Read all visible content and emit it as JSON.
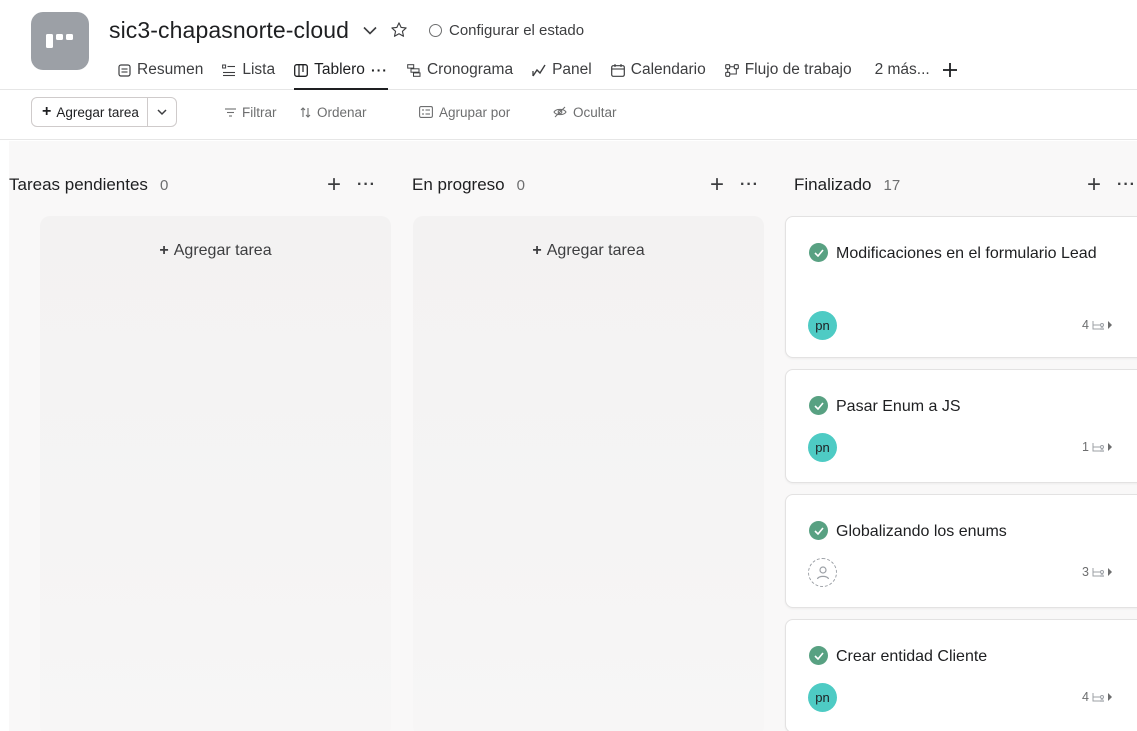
{
  "project": {
    "title": "sic3-chapasnorte-cloud",
    "status_label": "Configurar el estado"
  },
  "tabs": [
    {
      "label": "Resumen",
      "icon": "overview-icon"
    },
    {
      "label": "Lista",
      "icon": "list-icon"
    },
    {
      "label": "Tablero",
      "icon": "board-icon",
      "active": true,
      "dots": "···"
    },
    {
      "label": "Cronograma",
      "icon": "timeline-icon"
    },
    {
      "label": "Panel",
      "icon": "dashboard-icon"
    },
    {
      "label": "Calendario",
      "icon": "calendar-icon"
    },
    {
      "label": "Flujo de trabajo",
      "icon": "workflow-icon"
    }
  ],
  "tabs_more": "2 más...",
  "toolbar": {
    "add_task": "Agregar tarea",
    "filter": "Filtrar",
    "sort": "Ordenar",
    "group": "Agrupar por",
    "hide": "Ocultar"
  },
  "columns": [
    {
      "title": "Tareas pendientes",
      "count": "0",
      "add_task": "Agregar tarea"
    },
    {
      "title": "En progreso",
      "count": "0",
      "add_task": "Agregar tarea"
    },
    {
      "title": "Finalizado",
      "count": "17"
    }
  ],
  "cards": [
    {
      "title": "Modificaciones en el formulario Lead",
      "assignee": "pn",
      "subtasks": "4"
    },
    {
      "title": "Pasar Enum a JS",
      "assignee": "pn",
      "subtasks": "1"
    },
    {
      "title": "Globalizando los enums",
      "assignee": "",
      "subtasks": "3"
    },
    {
      "title": "Crear entidad Cliente",
      "assignee": "pn",
      "subtasks": "4"
    }
  ],
  "colors": {
    "check_green": "#58a182",
    "avatar_teal": "#4ecbc4",
    "project_icon_gray": "#9ca0a6"
  }
}
